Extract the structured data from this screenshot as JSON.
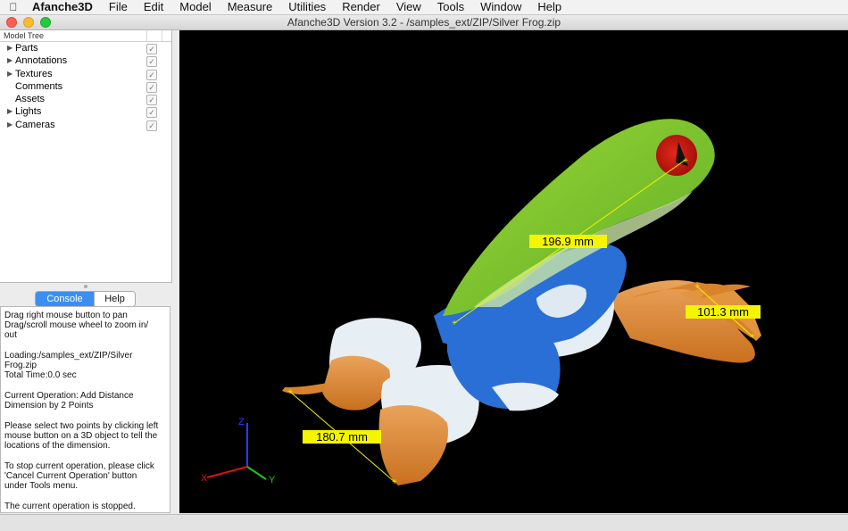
{
  "menubar": {
    "app_name": "Afanche3D",
    "items": [
      "File",
      "Edit",
      "Model",
      "Measure",
      "Utilities",
      "Render",
      "View",
      "Tools",
      "Window",
      "Help"
    ]
  },
  "window": {
    "title": "Afanche3D Version 3.2 - /samples_ext/ZIP/Silver Frog.zip"
  },
  "model_tree": {
    "header": "Model Tree",
    "items": [
      {
        "label": "Parts",
        "expandable": true,
        "checked": true
      },
      {
        "label": "Annotations",
        "expandable": true,
        "checked": true
      },
      {
        "label": "Textures",
        "expandable": true,
        "checked": true
      },
      {
        "label": "Comments",
        "expandable": false,
        "checked": true
      },
      {
        "label": "Assets",
        "expandable": false,
        "checked": true
      },
      {
        "label": "Lights",
        "expandable": true,
        "checked": true
      },
      {
        "label": "Cameras",
        "expandable": true,
        "checked": true
      }
    ]
  },
  "tabs": {
    "console": "Console",
    "help": "Help"
  },
  "console": {
    "lines": [
      "Drag right mouse button to pan\nDrag/scroll mouse wheel to zoom in/\nout",
      "Loading:/samples_ext/ZIP/Silver\nFrog.zip\nTotal Time:0.0 sec",
      "Current Operation: Add Distance\nDimension by 2 Points",
      "Please select two points by clicking left\nmouse button on a 3D object to tell the\nlocations of the dimension.",
      "To stop current operation, please click\n'Cancel Current Operation' button\nunder Tools menu.",
      "The current operation is stopped."
    ]
  },
  "viewport": {
    "dimensions": [
      "196.9 mm",
      "101.3 mm",
      "180.7 mm"
    ],
    "axes": {
      "x": "X",
      "y": "Y",
      "z": "Z"
    },
    "colors": {
      "background": "#000000",
      "frog_green": "#7bc62e",
      "frog_blue": "#2a6fd6",
      "frog_orange": "#d8832c",
      "eye_red": "#c8140f",
      "dimension_label_bg": "#f5f500"
    }
  }
}
